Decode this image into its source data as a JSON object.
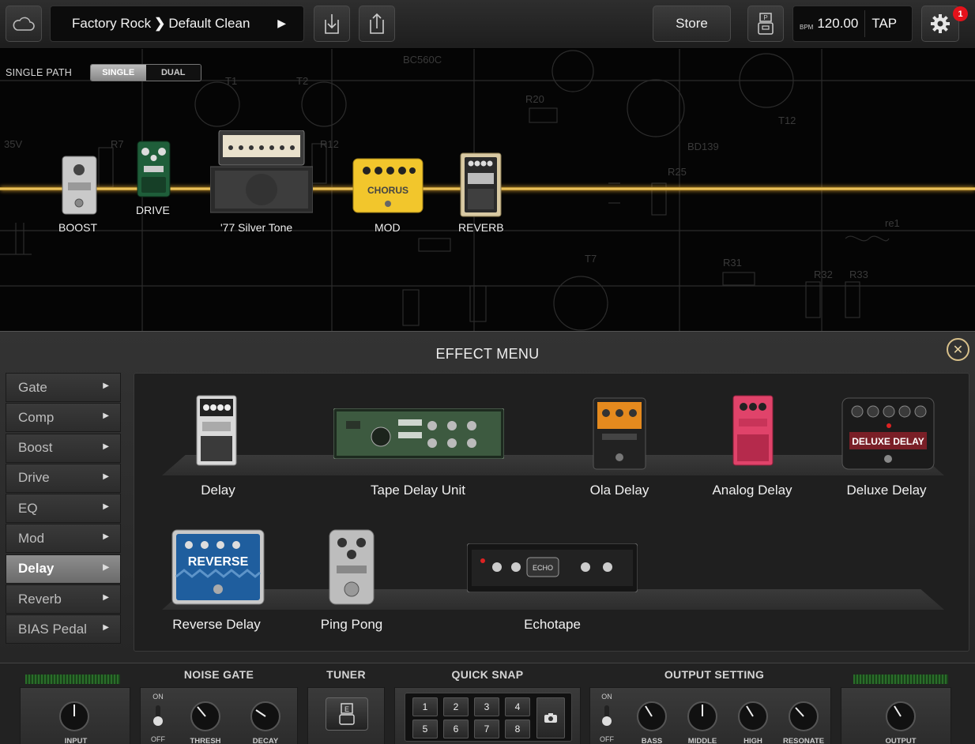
{
  "header": {
    "preset_bank": "Factory Rock",
    "preset_name": "Default Clean",
    "store_label": "Store",
    "bpm_label": "BPM",
    "bpm_value": "120.00",
    "tap_label": "TAP",
    "notification_count": "1"
  },
  "chain": {
    "path_label": "SINGLE PATH",
    "path_options": [
      "SINGLE",
      "DUAL"
    ],
    "slots": [
      {
        "label": "BOOST"
      },
      {
        "label": "DRIVE"
      },
      {
        "label": "'77 Silver Tone"
      },
      {
        "label": "MOD"
      },
      {
        "label": "REVERB"
      }
    ]
  },
  "menu": {
    "title": "EFFECT MENU",
    "categories": [
      "Gate",
      "Comp",
      "Boost",
      "Drive",
      "EQ",
      "Mod",
      "Delay",
      "Reverb",
      "BIAS Pedal"
    ],
    "active_category": "Delay",
    "effects": [
      "Delay",
      "Tape Delay Unit",
      "Ola Delay",
      "Analog Delay",
      "Deluxe Delay",
      "Reverse Delay",
      "Ping Pong",
      "Echotape"
    ]
  },
  "bottom": {
    "noise_gate_title": "NOISE GATE",
    "tuner_title": "TUNER",
    "quick_snap_title": "QUICK SNAP",
    "output_setting_title": "OUTPUT SETTING",
    "on_label": "ON",
    "off_label": "OFF",
    "knobs": {
      "input": "INPUT",
      "thresh": "THRESH",
      "decay": "DECAY",
      "bass": "BASS",
      "middle": "MIDDLE",
      "high": "HIGH",
      "resonate": "RESONATE",
      "output": "OUTPUT"
    },
    "snaps": [
      "1",
      "2",
      "3",
      "4",
      "5",
      "6",
      "7",
      "8"
    ]
  },
  "colors": {
    "signal": "#ffd46e",
    "accent": "#d8c08a",
    "badge": "#e5121b",
    "active_category": "#7d7d7d"
  }
}
